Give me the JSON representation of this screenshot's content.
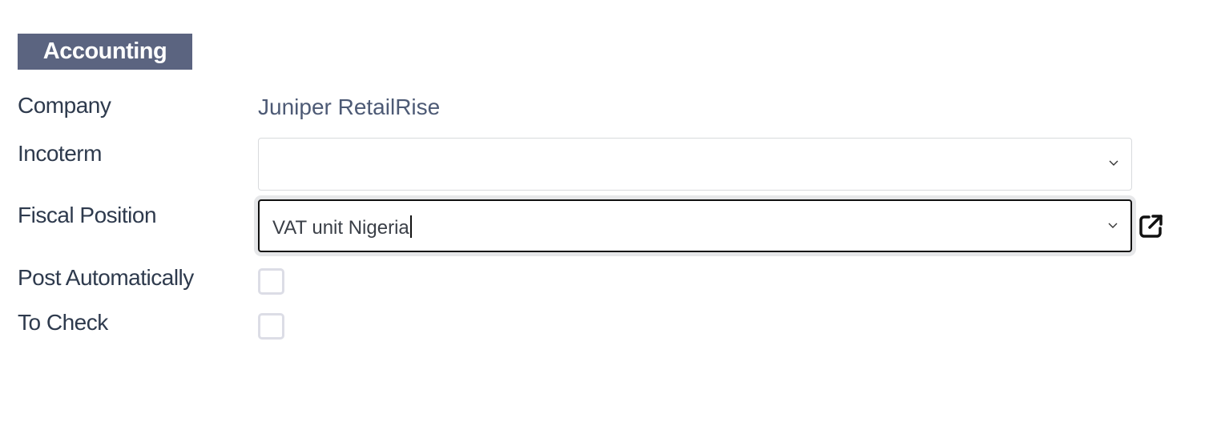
{
  "section": {
    "title": "Accounting"
  },
  "fields": {
    "company": {
      "label": "Company",
      "value": "Juniper RetailRise"
    },
    "incoterm": {
      "label": "Incoterm",
      "value": ""
    },
    "fiscal_position": {
      "label": "Fiscal Position",
      "value": "VAT unit Nigeria"
    },
    "post_automatically": {
      "label": "Post Automatically",
      "checked": false
    },
    "to_check": {
      "label": "To Check",
      "checked": false
    }
  },
  "colors": {
    "section_bg": "#5b6480",
    "label": "#2e3a4d",
    "readonly_value": "#4d5a75",
    "focus_border": "#111111"
  },
  "icons": {
    "dropdown": "chevron-down-icon",
    "external": "external-link-icon"
  }
}
